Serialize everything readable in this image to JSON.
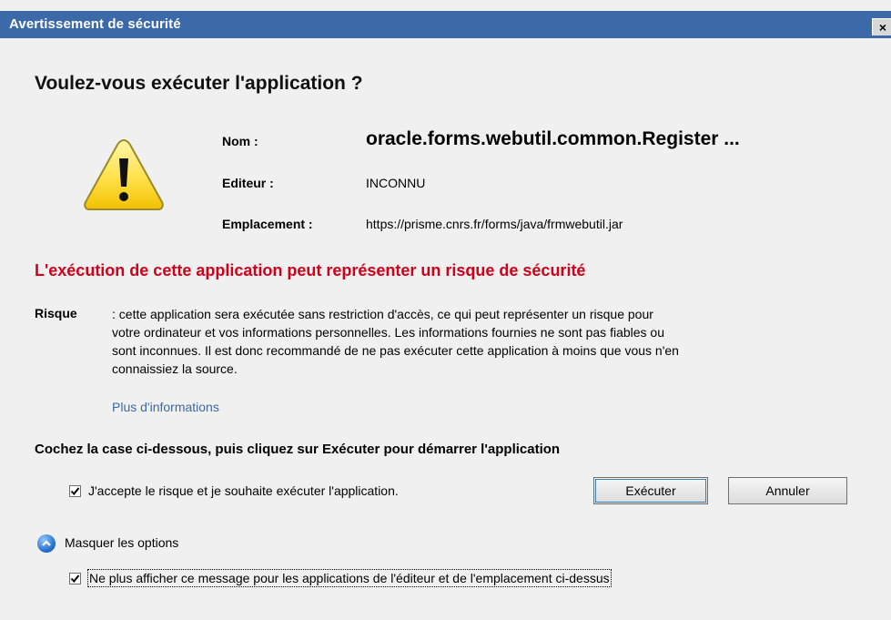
{
  "window": {
    "title": "Avertissement de sécurité",
    "close_glyph": "×"
  },
  "question": "Voulez-vous exécuter l'application ?",
  "icons": {
    "warning": "warning-triangle-icon",
    "toggle": "chevron-up-circle-icon",
    "check": "check-icon"
  },
  "info": {
    "name_label": "Nom :",
    "name_value": "oracle.forms.webutil.common.Register ...",
    "publisher_label": "Editeur :",
    "publisher_value": "INCONNU",
    "location_label": "Emplacement :",
    "location_value": "https://prisme.cnrs.fr/forms/java/frmwebutil.jar"
  },
  "risk": {
    "heading": "L'exécution de cette application peut représenter un risque de sécurité",
    "label": "Risque",
    "line1": ": cette application sera exécutée sans restriction d'accès, ce qui peut représenter un risque pour",
    "line2": "votre ordinateur et vos informations personnelles. Les informations fournies ne sont pas fiables ou",
    "line3": "sont inconnues. Il est donc recommandé de ne pas exécuter cette application à moins que vous n'en",
    "line4": "connaissiez la source.",
    "more_link": "Plus d'informations"
  },
  "instruction": "Cochez la case ci-dessous, puis cliquez sur Exécuter pour démarrer l'application",
  "accept_checkbox": {
    "label": "J'accepte le risque et je souhaite exécuter l'application.",
    "checked": true
  },
  "buttons": {
    "run": "Exécuter",
    "cancel": "Annuler"
  },
  "options_toggle": "Masquer les options",
  "dont_show_checkbox": {
    "label": "Ne plus afficher ce message pour les applications de l'éditeur et de l'emplacement ci-dessus",
    "checked": true
  },
  "colors": {
    "titlebar": "#3c69a8",
    "risk_heading": "#d0001a",
    "link": "#3d6aa0",
    "background": "#f0f0f0"
  }
}
